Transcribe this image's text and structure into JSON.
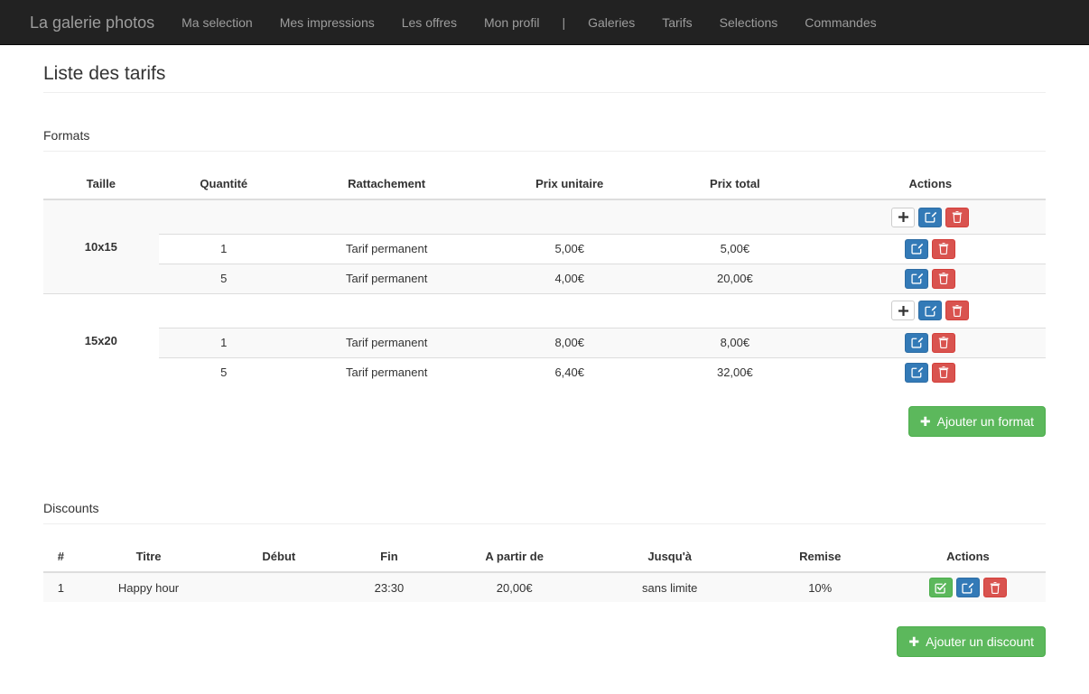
{
  "navbar": {
    "brand": "La galerie photos",
    "separator": "|",
    "left_items": [
      {
        "label": "Ma selection"
      },
      {
        "label": "Mes impressions"
      },
      {
        "label": "Les offres"
      },
      {
        "label": "Mon profil"
      }
    ],
    "right_items": [
      {
        "label": "Galeries"
      },
      {
        "label": "Tarifs"
      },
      {
        "label": "Selections"
      },
      {
        "label": "Commandes"
      }
    ]
  },
  "page": {
    "title": "Liste des tarifs"
  },
  "formats_section": {
    "heading": "Formats",
    "columns": [
      "Taille",
      "Quantité",
      "Rattachement",
      "Prix unitaire",
      "Prix total",
      "Actions"
    ],
    "groups": [
      {
        "size": "10x15",
        "rows": [
          {
            "quantity": "1",
            "rattachement": "Tarif permanent",
            "unit_price": "5,00€",
            "total_price": "5,00€"
          },
          {
            "quantity": "5",
            "rattachement": "Tarif permanent",
            "unit_price": "4,00€",
            "total_price": "20,00€"
          }
        ]
      },
      {
        "size": "15x20",
        "rows": [
          {
            "quantity": "1",
            "rattachement": "Tarif permanent",
            "unit_price": "8,00€",
            "total_price": "8,00€"
          },
          {
            "quantity": "5",
            "rattachement": "Tarif permanent",
            "unit_price": "6,40€",
            "total_price": "32,00€"
          }
        ]
      }
    ],
    "add_button": {
      "label": "Ajouter un format",
      "icon": "plus-icon",
      "color": "#5cb85c"
    },
    "row_actions": {
      "add_icon": "plus-icon",
      "edit_icon": "edit-square-icon",
      "delete_icon": "trash-icon"
    }
  },
  "discounts_section": {
    "heading": "Discounts",
    "columns": [
      "#",
      "Titre",
      "Début",
      "Fin",
      "A partir de",
      "Jusqu'à",
      "Remise",
      "Actions"
    ],
    "rows": [
      {
        "num": "1",
        "titre": "Happy hour",
        "debut": "",
        "fin": "23:30",
        "a_partir_de": "20,00€",
        "jusqua": "sans limite",
        "remise": "10%"
      }
    ],
    "row_actions": {
      "validate_icon": "check-square-icon",
      "edit_icon": "edit-square-icon",
      "delete_icon": "trash-icon"
    },
    "add_button": {
      "label": "Ajouter un discount",
      "icon": "plus-icon",
      "color": "#5cb85c"
    }
  },
  "theme": {
    "navbar_bg": "#222222",
    "navbar_text": "#9d9d9d",
    "primary": "#337ab7",
    "danger": "#d9534f",
    "success": "#5cb85c",
    "stripe": "#f9f9f9"
  }
}
